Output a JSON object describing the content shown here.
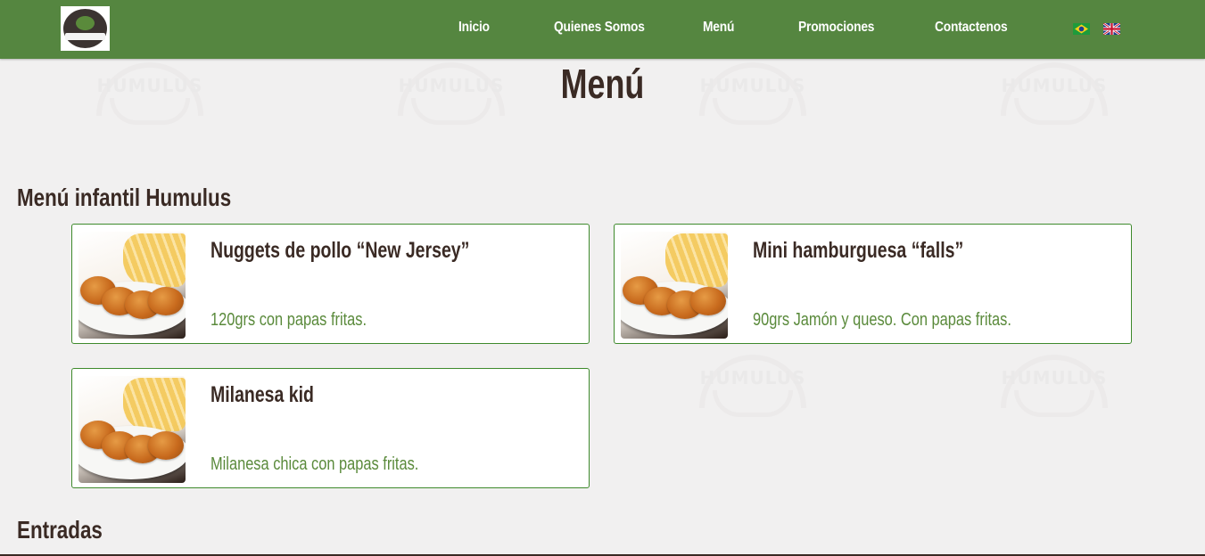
{
  "header": {
    "nav": [
      {
        "label": "Inicio"
      },
      {
        "label": "Quienes Somos"
      },
      {
        "label": "Menú"
      },
      {
        "label": "Promociones"
      },
      {
        "label": "Contactenos"
      }
    ],
    "logo_text": "HUMULUS",
    "flags": [
      "brazil-flag-icon",
      "uk-flag-icon"
    ],
    "bar_color": "#558640"
  },
  "page": {
    "title": "Menú",
    "watermark_text": "HUMULUS"
  },
  "sections": [
    {
      "title": "Menú infantil Humulus",
      "items": [
        {
          "name": "Nuggets de pollo “New Jersey”",
          "description": "120grs con papas fritas."
        },
        {
          "name": "Mini hamburguesa “falls”",
          "description": "90grs Jamón y queso. Con papas fritas."
        },
        {
          "name": "Milanesa kid",
          "description": "Milanesa chica con papas fritas."
        }
      ]
    },
    {
      "title": "Entradas",
      "items": []
    }
  ],
  "colors": {
    "accent": "#5a8a3b",
    "text": "#3a2a24",
    "card_border": "#3e8a2c",
    "background": "#f1f0f0"
  }
}
